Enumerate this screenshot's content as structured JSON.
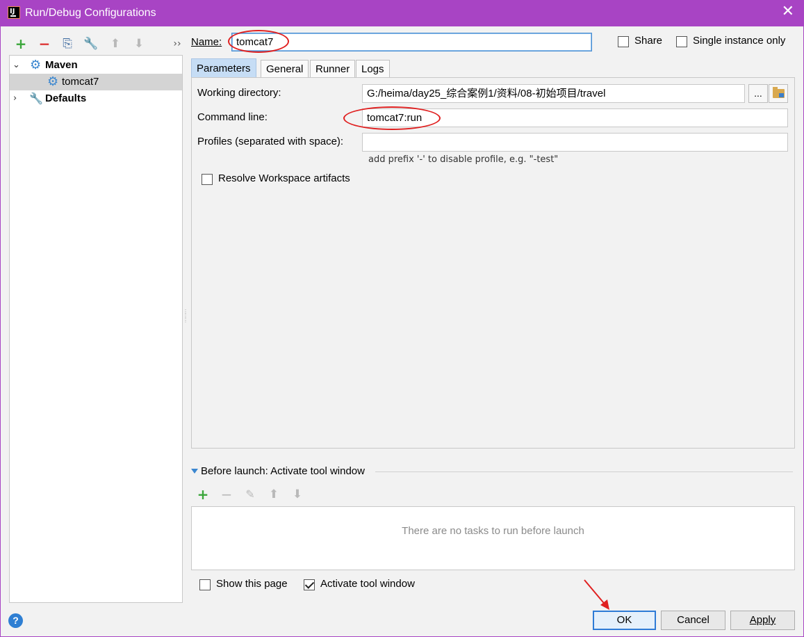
{
  "window": {
    "title": "Run/Debug Configurations",
    "close_glyph": "✕"
  },
  "toolbar": {
    "add_icon": "+",
    "remove_icon": "−",
    "copy_icon": "⎘",
    "edit_icon": "🔧",
    "up_icon": "⬆",
    "down_icon": "⬇",
    "more_icon": "››"
  },
  "tree": {
    "items": [
      {
        "label": "Maven",
        "expanded": true,
        "icon": "gear-icon"
      },
      {
        "label": "tomcat7",
        "selected": true,
        "icon": "gear-icon"
      },
      {
        "label": "Defaults",
        "expanded": false,
        "icon": "wrench-icon"
      }
    ]
  },
  "name_field": {
    "label": "Name:",
    "value": "tomcat7"
  },
  "share": {
    "label": "Share",
    "checked": false
  },
  "single_instance": {
    "label": "Single instance only",
    "checked": false
  },
  "tabs": [
    {
      "label": "Parameters",
      "active": true
    },
    {
      "label": "General",
      "active": false
    },
    {
      "label": "Runner",
      "active": false
    },
    {
      "label": "Logs",
      "active": false
    }
  ],
  "parameters": {
    "working_directory": {
      "label": "Working directory:",
      "value": "G:/heima/day25_综合案例1/资料/08-初始项目/travel",
      "browse_label": "..."
    },
    "command_line": {
      "label": "Command line:",
      "value": "tomcat7:run"
    },
    "profiles": {
      "label": "Profiles (separated with space):",
      "value": "",
      "hint": "add prefix '-' to disable profile, e.g. \"-test\""
    },
    "resolve_workspace": {
      "label": "Resolve Workspace artifacts",
      "checked": false
    }
  },
  "before_launch": {
    "title": "Before launch: Activate tool window",
    "empty_text": "There are no tasks to run before launch",
    "show_this_page": {
      "label": "Show this page",
      "checked": false
    },
    "activate_tool_window": {
      "label": "Activate tool window",
      "checked": true
    }
  },
  "buttons": {
    "ok": "OK",
    "cancel": "Cancel",
    "apply": "Apply",
    "help": "?"
  },
  "colors": {
    "titlebar": "#a844c4",
    "annotation": "#e02020",
    "accent": "#2e7bd6"
  }
}
